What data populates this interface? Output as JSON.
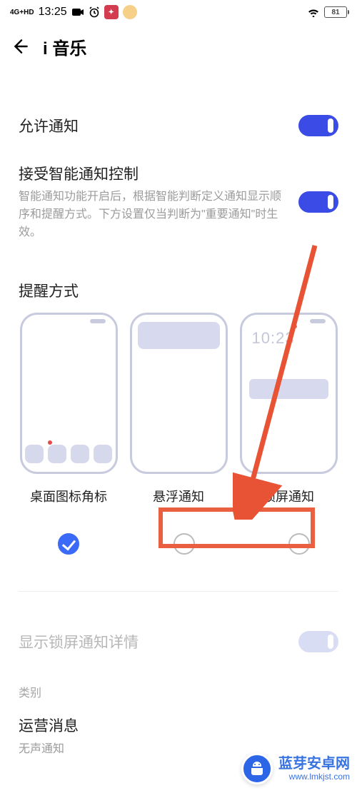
{
  "status": {
    "network": "4G+HD",
    "time": "13:25",
    "battery": "81"
  },
  "header": {
    "title": "i 音乐"
  },
  "rows": {
    "allow_notify": "允许通知",
    "smart_control_title": "接受智能通知控制",
    "smart_control_desc": "智能通知功能开启后，根据智能判断定义通知显示顺序和提醒方式。下方设置仅当判断为\"重要通知\"时生效。",
    "reminder_title": "提醒方式",
    "show_lock_detail": "显示锁屏通知详情",
    "category_label": "类别"
  },
  "methods": {
    "badge": "桌面图标角标",
    "floating": "悬浮通知",
    "lock": "锁屏通知",
    "lock_time": "10:23"
  },
  "messages": {
    "ops_title": "运营消息",
    "ops_sub": "无声通知"
  },
  "watermark": {
    "name": "蓝芽安卓网",
    "url": "www.lmkjst.com"
  }
}
